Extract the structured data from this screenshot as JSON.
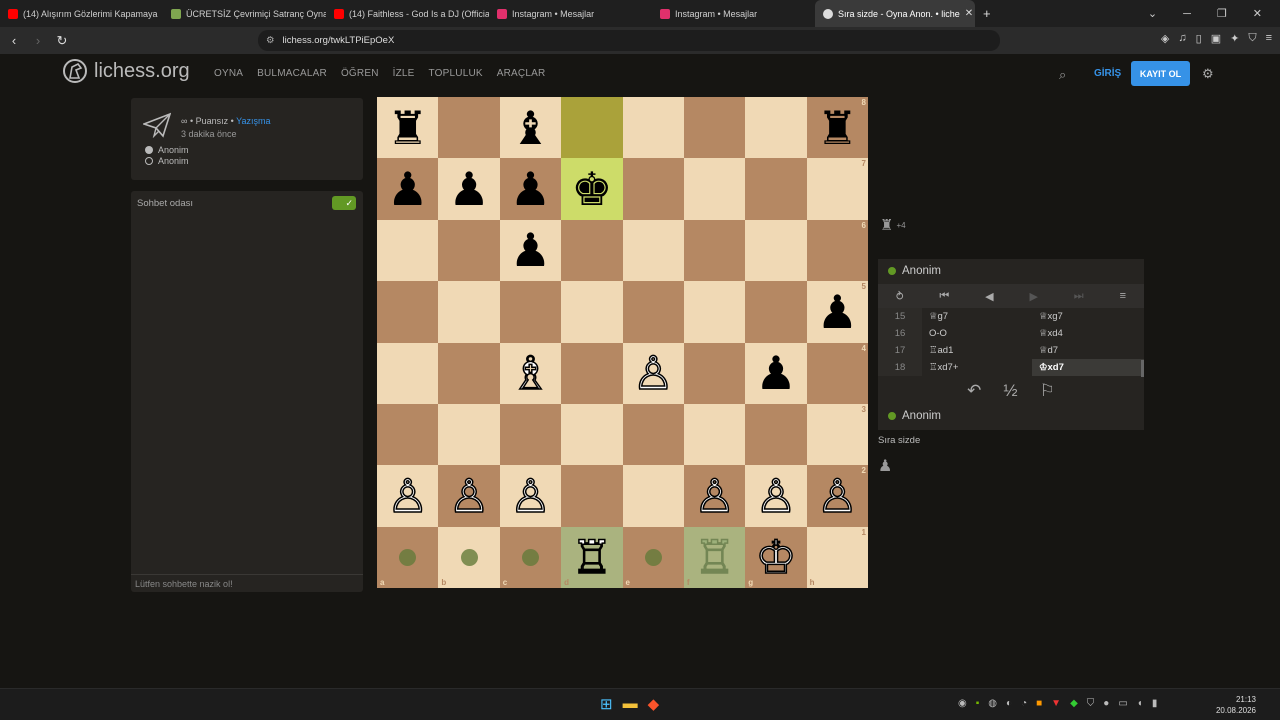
{
  "browser": {
    "tabs": [
      {
        "title": "(14) Alışırım Gözlerimi Kapamaya",
        "fav": "#ff0000"
      },
      {
        "title": "ÜCRETSİZ Çevrimiçi Satranç Oynayın",
        "fav": "#7fa650"
      },
      {
        "title": "(14) Faithless - God Is a DJ (Official Vi",
        "fav": "#ff0000"
      },
      {
        "title": "Instagram • Mesajlar",
        "fav": "#e1306c"
      },
      {
        "title": "Instagram • Mesajlar",
        "fav": "#e1306c"
      },
      {
        "title": "Sıra sizde - Oyna Anon. • liche",
        "fav": "#dddddd"
      }
    ],
    "url": "lichess.org/twkLTPiEpOeX"
  },
  "header": {
    "logo_text": "lichess.org",
    "nav": [
      "OYNA",
      "BULMACALAR",
      "ÖĞREN",
      "İZLE",
      "TOPLULUK",
      "ARAÇLAR"
    ],
    "login": "GİRİŞ",
    "signup": "KAYIT OL"
  },
  "game_info": {
    "rated": "Puansız",
    "separator": "•",
    "mode": "Yazışma",
    "time_ago": "3 dakika önce",
    "player_white": "Anonim",
    "player_black": "Anonim"
  },
  "chat": {
    "title": "Sohbet odası",
    "placeholder": "Lütfen sohbette nazik ol!"
  },
  "board": {
    "ranks": [
      "8",
      "7",
      "6",
      "5",
      "4",
      "3",
      "2",
      "1"
    ],
    "files": [
      "a",
      "b",
      "c",
      "d",
      "e",
      "f",
      "g",
      "h"
    ],
    "pieces": {
      "a8": "♜",
      "c8": "♝",
      "h8": "♜",
      "a7": "♟",
      "b7": "♟",
      "c7": "♟",
      "d7": "♚",
      "c6": "♟",
      "h5": "♟",
      "c4": "♗",
      "e4": "♙",
      "g4": "♟",
      "a2": "♙",
      "b2": "♙",
      "c2": "♙",
      "f2": "♙",
      "g2": "♙",
      "h2": "♙",
      "d1": "♖",
      "f1": "♖",
      "g1": "♔"
    }
  },
  "material": {
    "icon": "♜",
    "diff": "+4"
  },
  "panel": {
    "opponent": "Anonim",
    "player": "Anonim",
    "moves": [
      {
        "num": "15",
        "white": "♕g7",
        "black": "♕xg7"
      },
      {
        "num": "16",
        "white": "O-O",
        "black": "♕xd4"
      },
      {
        "num": "17",
        "white": "♖ad1",
        "black": "♕d7"
      },
      {
        "num": "18",
        "white": "♖xd7+",
        "black": "♔xd7"
      }
    ],
    "draw": "½",
    "your_turn": "Sıra sizde"
  },
  "clock": {
    "time": "21:13",
    "date": "20.08.2026"
  }
}
